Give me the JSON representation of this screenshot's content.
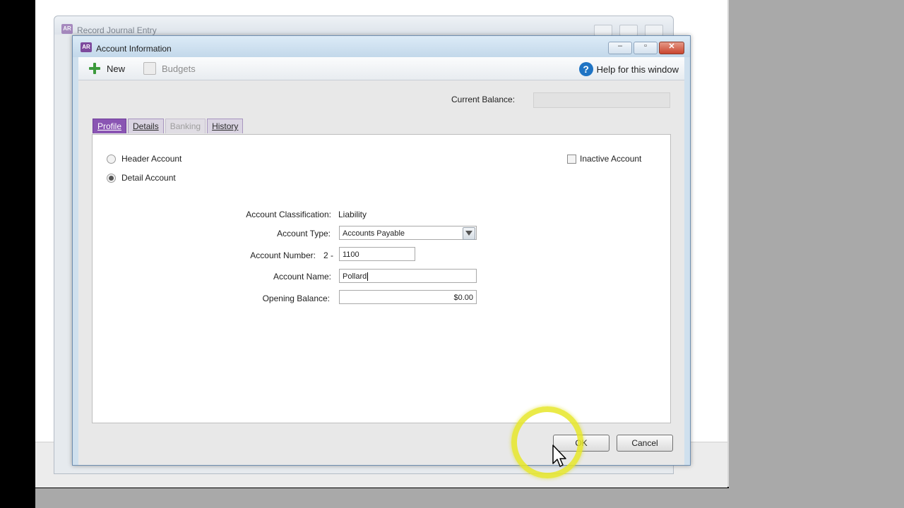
{
  "back_window": {
    "title": "Record Journal Entry"
  },
  "dialog": {
    "title": "Account Information",
    "app_icon_text": "AR",
    "window_controls": {
      "minimize": "–",
      "maximize": "▫",
      "close": "✕"
    }
  },
  "toolbar": {
    "new_label": "New",
    "budgets_label": "Budgets",
    "help_label": "Help for this window",
    "help_glyph": "?"
  },
  "balance": {
    "label": "Current Balance:",
    "value": ""
  },
  "tabs": [
    {
      "label": "Profile",
      "state": "active"
    },
    {
      "label": "Details",
      "state": "normal"
    },
    {
      "label": "Banking",
      "state": "disabled"
    },
    {
      "label": "History",
      "state": "normal"
    }
  ],
  "profile": {
    "header_account_label": "Header Account",
    "detail_account_label": "Detail Account",
    "selected_account_kind": "Detail Account",
    "inactive_account_label": "Inactive Account",
    "inactive_checked": false,
    "classification_label": "Account Classification:",
    "classification_value": "Liability",
    "type_label": "Account Type:",
    "type_value": "Accounts Payable",
    "number_label": "Account Number:",
    "number_prefix": "2 -",
    "number_value": "1100",
    "name_label": "Account Name:",
    "name_value": "Pollard",
    "opening_label": "Opening Balance:",
    "opening_value": "$0.00"
  },
  "buttons": {
    "ok": "OK",
    "cancel": "Cancel"
  },
  "colors": {
    "tab_active": "#8a55b3",
    "highlight": "#e6e628",
    "titlebar": "#c3d8ea"
  }
}
